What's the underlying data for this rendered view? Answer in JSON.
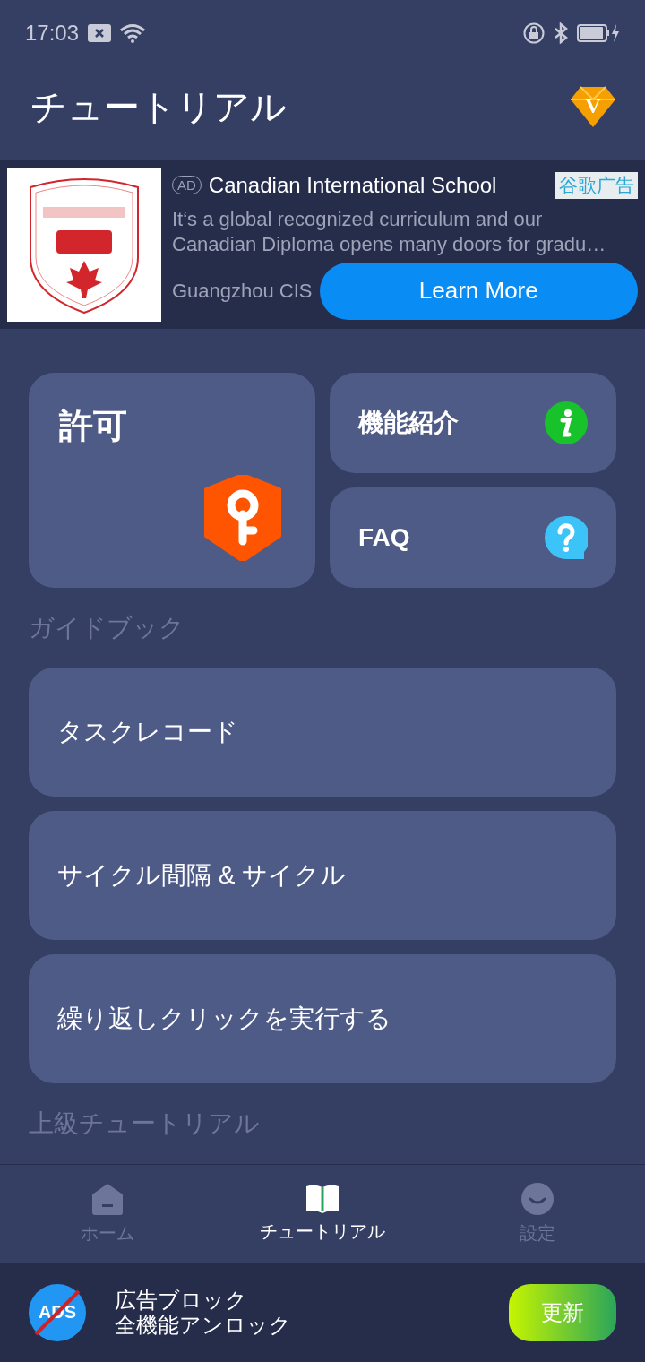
{
  "status_bar": {
    "time": "17:03"
  },
  "header": {
    "title": "チュートリアル",
    "badge": "V"
  },
  "ad": {
    "tag": "AD",
    "title": "Canadian International School",
    "label": "谷歌广告",
    "body_lines": [
      "It‘s a global recognized curriculum and our",
      "Canadian Diploma opens many doors for gradu…"
    ],
    "advertiser": "Guangzhou CIS",
    "button": "Learn More"
  },
  "tiles": [
    {
      "kind": "permission",
      "label": "許可"
    },
    {
      "kind": "info",
      "label": "機能紹介"
    },
    {
      "kind": "faq",
      "label": "FAQ"
    }
  ],
  "guide": {
    "title": "ガイドブック",
    "items": [
      "タスクレコード",
      "サイクル間隔 & サイクル",
      "繰り返しクリックを実行する"
    ]
  },
  "advanced": {
    "title": "上級チュートリアル"
  },
  "nav": [
    {
      "kind": "home",
      "label": "ホーム",
      "selected": false
    },
    {
      "kind": "tutorial",
      "label": "チュートリアル",
      "selected": true
    },
    {
      "kind": "settings",
      "label": "設定",
      "selected": false
    }
  ],
  "promo": {
    "icon_text": "ADS",
    "lines": [
      "広告ブロック",
      "全機能アンロック"
    ],
    "button": "更新"
  }
}
